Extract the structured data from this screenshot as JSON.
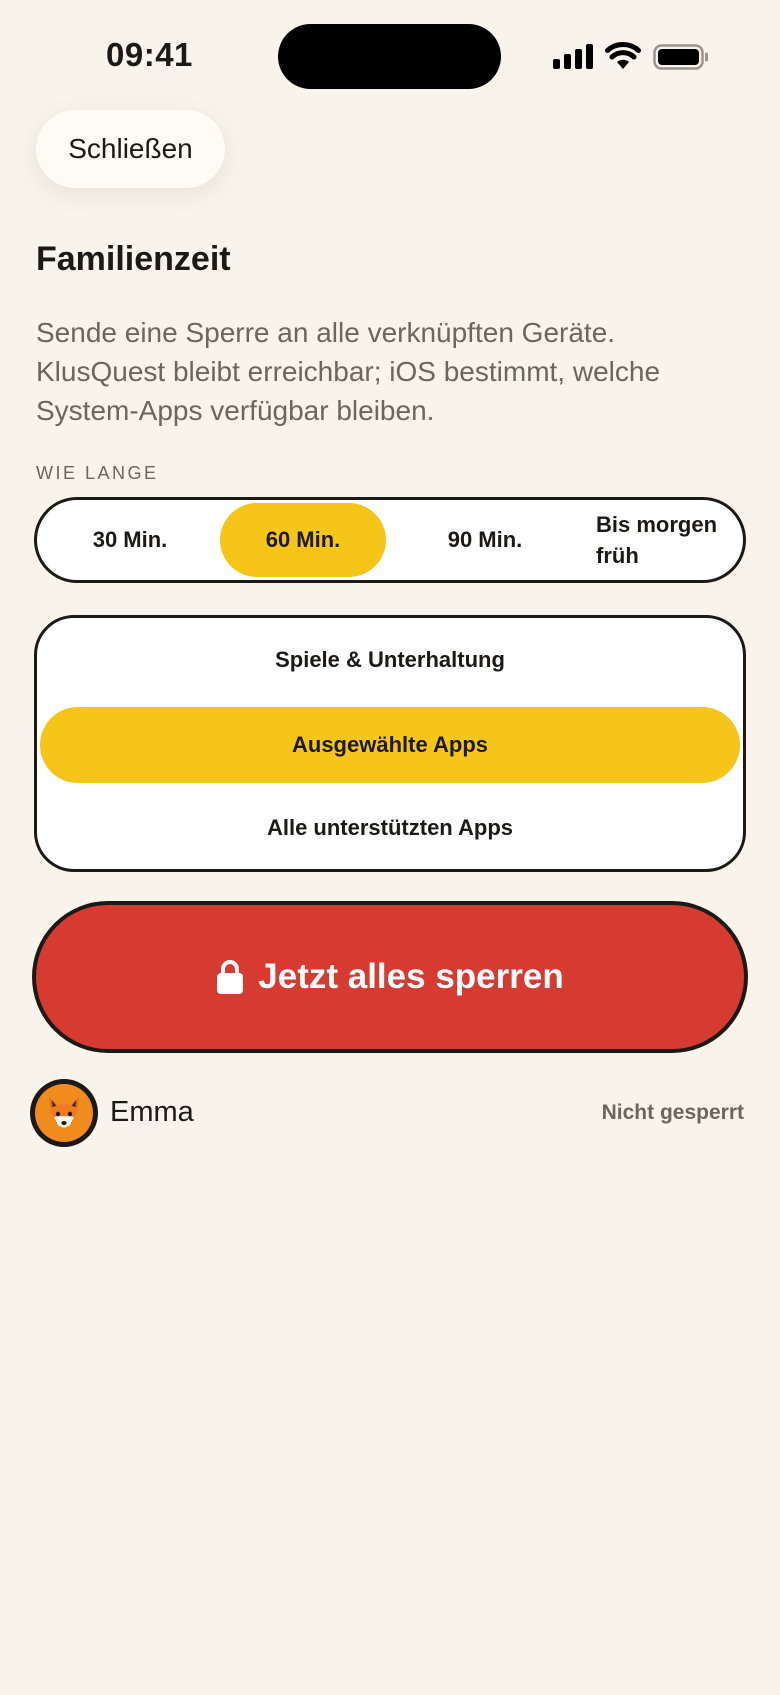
{
  "status_bar": {
    "time": "09:41"
  },
  "header": {
    "close_label": "Schließen"
  },
  "page": {
    "title": "Familienzeit",
    "description": "Sende eine Sperre an alle verknüpften Geräte. KlusQuest bleibt erreichbar; iOS bestimmt, welche System-Apps verfügbar bleiben."
  },
  "duration": {
    "section_label": "WIE LANGE",
    "options": [
      {
        "label": "30 Min."
      },
      {
        "label": "60 Min."
      },
      {
        "label": "90 Min."
      },
      {
        "label_line1": "Bis morgen",
        "label_line2": "früh"
      }
    ],
    "selected": "60 Min."
  },
  "scope": {
    "options": [
      {
        "label": "Spiele & Unterhaltung"
      },
      {
        "label": "Ausgewählte Apps"
      },
      {
        "label": "Alle unterstützten Apps"
      }
    ],
    "selected": "Ausgewählte Apps"
  },
  "action": {
    "lock_label": "Jetzt alles sperren"
  },
  "members": [
    {
      "name": "Emma",
      "status": "Nicht gesperrt",
      "avatar_icon": "fox-icon"
    }
  ],
  "colors": {
    "background": "#f8f4ec",
    "accent_yellow": "#f5c518",
    "danger_red": "#d63a30",
    "avatar_orange": "#f08c1c"
  }
}
